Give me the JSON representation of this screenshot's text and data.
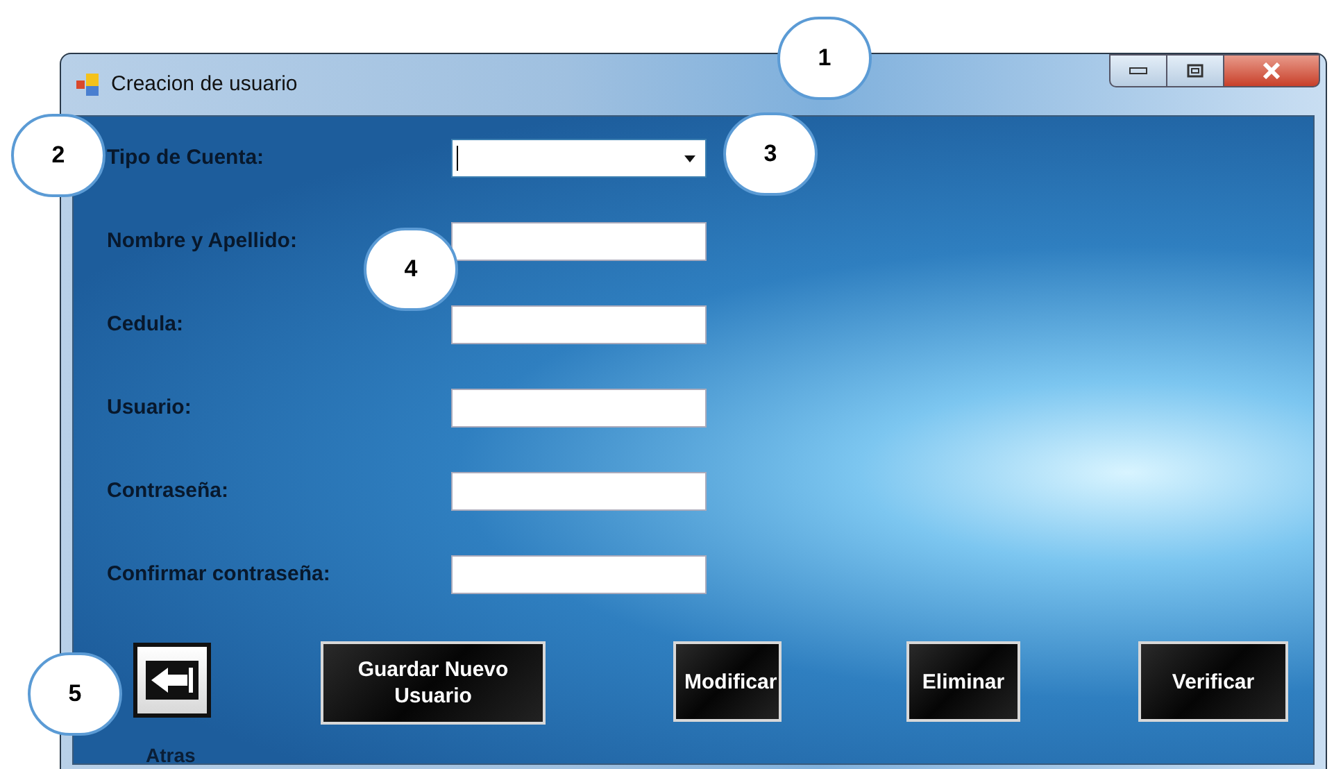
{
  "window": {
    "title": "Creacion de usuario"
  },
  "fields": [
    {
      "label": "Tipo de Cuenta:",
      "kind": "dropdown",
      "focused": true
    },
    {
      "label": "Nombre y Apellido:",
      "kind": "text",
      "focused": false
    },
    {
      "label": "Cedula:",
      "kind": "text",
      "focused": false
    },
    {
      "label": "Usuario:",
      "kind": "text",
      "focused": false
    },
    {
      "label": "Contraseña:",
      "kind": "text",
      "focused": false
    },
    {
      "label": "Confirmar contraseña:",
      "kind": "text",
      "focused": false
    }
  ],
  "back_button": {
    "label": "Atras"
  },
  "buttons": [
    {
      "label": "Guardar Nuevo Usuario"
    },
    {
      "label": "Modificar"
    },
    {
      "label": "Eliminar"
    },
    {
      "label": "Verificar"
    }
  ],
  "callouts": [
    "1",
    "2",
    "3",
    "4",
    "5"
  ]
}
